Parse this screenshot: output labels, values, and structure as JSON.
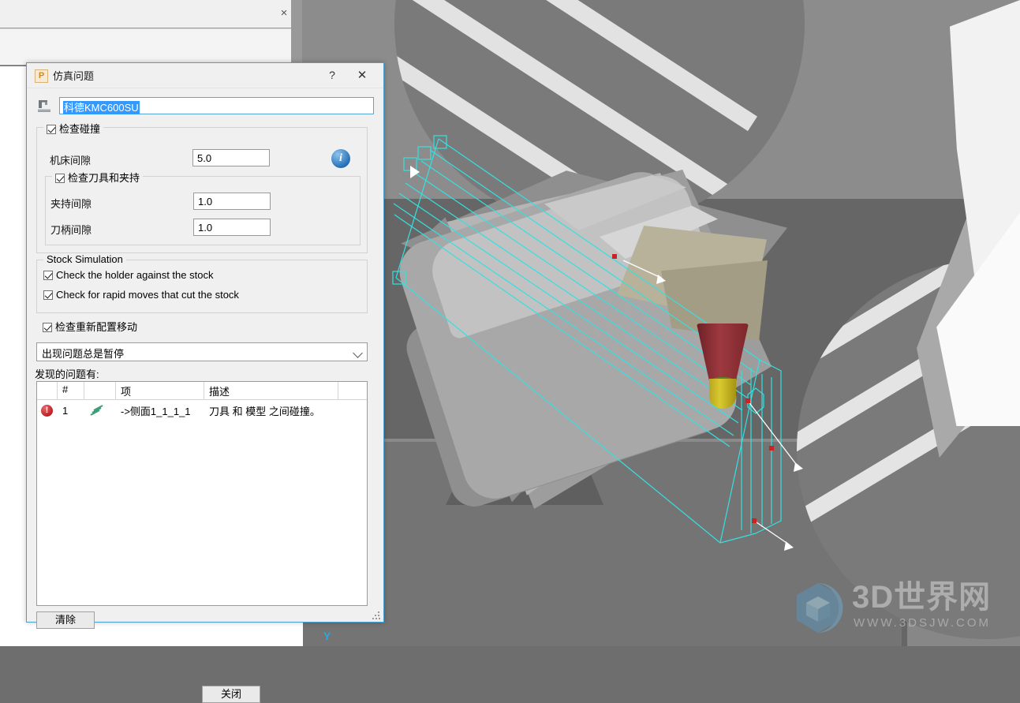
{
  "background_window": {
    "close_label": "×"
  },
  "viewport": {
    "axis_label_y": "Y",
    "watermark": {
      "text": "3D世界网",
      "url": "WWW.3DSJW.COM"
    }
  },
  "dialog": {
    "app_icon_letter": "P",
    "title": "仿真问题",
    "help_label": "?",
    "close_label": "✕",
    "machine": {
      "icon_name": "machine-tool-icon",
      "value": "科德KMC600SU"
    },
    "collision_group": {
      "legend": "检查碰撞",
      "checked": true,
      "machine_clearance_label": "机床间隙",
      "machine_clearance_value": "5.0",
      "info_icon": "i",
      "tool_group": {
        "legend": "检查刀具和夹持",
        "checked": true,
        "holder_clearance_label": "夹持间隙",
        "holder_clearance_value": "1.0",
        "shank_clearance_label": "刀柄间隙",
        "shank_clearance_value": "1.0"
      }
    },
    "stock_group": {
      "legend": "Stock Simulation",
      "options": [
        {
          "label": "Check the holder against the stock",
          "checked": true
        },
        {
          "label": "Check for rapid moves that cut the stock",
          "checked": true
        }
      ]
    },
    "recheck": {
      "label": "检查重新配置移动",
      "checked": true
    },
    "action_dropdown": {
      "selected": "出现问题总是暂停"
    },
    "problems": {
      "label": "发现的问题有:",
      "columns": [
        "",
        "#",
        "",
        "项",
        "描述",
        ""
      ],
      "rows": [
        {
          "status_icon": "!",
          "num": "1",
          "item_icon": "toolpath-icon",
          "item": "->侧面1_1_1_1",
          "description": "刀具 和 模型 之间碰撞。"
        }
      ]
    },
    "buttons": {
      "clear": "清除",
      "close": "关闭"
    }
  },
  "colors": {
    "accent_border": "#4a9fd4",
    "selection_blue": "#3399ff",
    "toolpath_cyan": "#35e0e0",
    "tool_holder_red": "#9d3a3f",
    "tool_shank_yellow": "#d9c92f",
    "error_red": "#c01f22"
  }
}
